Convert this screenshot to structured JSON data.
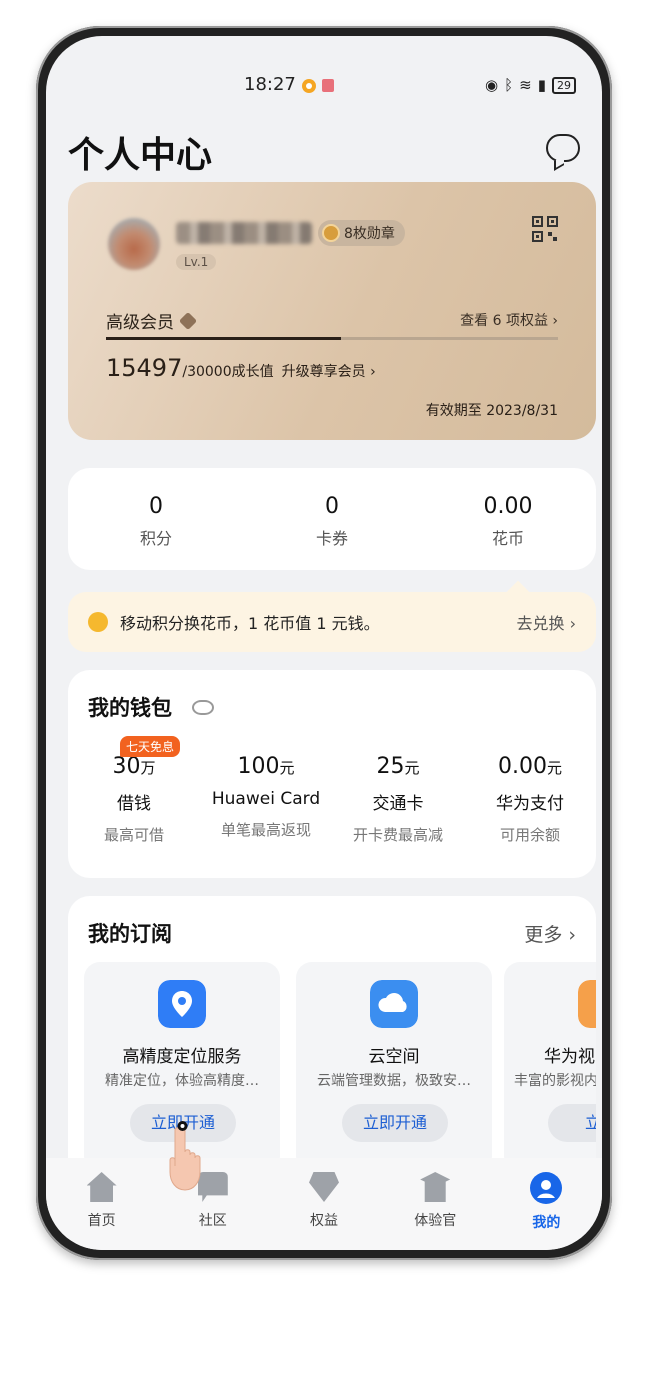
{
  "status_bar": {
    "time": "18:27",
    "battery": "29"
  },
  "header": {
    "title": "个人中心"
  },
  "member_card": {
    "medals": "8枚勋章",
    "level": "Lv.1",
    "tier": "高级会员",
    "benefits": "查看 6 项权益 ›",
    "growth_value": "15497",
    "growth_total": "/30000成长值",
    "upgrade": "升级尊享会员 ›",
    "expiry": "有效期至 2023/8/31",
    "progress_fraction": 0.52
  },
  "stats": [
    {
      "value": "0",
      "label": "积分"
    },
    {
      "value": "0",
      "label": "卡券"
    },
    {
      "value": "0.00",
      "label": "花币"
    }
  ],
  "exchange": {
    "text": "移动积分换花币，1 花币值 1 元钱。",
    "link": "去兑换 ›"
  },
  "wallet": {
    "title": "我的钱包",
    "promo": "七天免息",
    "items": [
      {
        "value": "30",
        "unit": "万",
        "name": "借钱",
        "sub": "最高可借"
      },
      {
        "value": "100",
        "unit": "元",
        "name": "Huawei Card",
        "sub": "单笔最高返现"
      },
      {
        "value": "25",
        "unit": "元",
        "name": "交通卡",
        "sub": "开卡费最高减"
      },
      {
        "value": "0.00",
        "unit": "元",
        "name": "华为支付",
        "sub": "可用余额"
      }
    ]
  },
  "subscriptions": {
    "title": "我的订阅",
    "more": "更多 ›",
    "items": [
      {
        "name": "高精度定位服务",
        "desc": "精准定位，体验高精度…",
        "button": "立即开通",
        "icon_color": "#2f7df6",
        "icon": "location-pin-icon"
      },
      {
        "name": "云空间",
        "desc": "云端管理数据，极致安…",
        "button": "立即开通",
        "icon_color": "#3b8ef0",
        "icon": "cloud-icon"
      },
      {
        "name": "华为视",
        "desc": "丰富的影视内",
        "button": "立即",
        "icon_color": "#f5a04a",
        "icon": "video-icon"
      }
    ]
  },
  "nav": [
    {
      "label": "首页",
      "icon": "home-icon"
    },
    {
      "label": "社区",
      "icon": "chat-icon"
    },
    {
      "label": "权益",
      "icon": "gift-icon"
    },
    {
      "label": "体验官",
      "icon": "graduation-cap-icon"
    },
    {
      "label": "我的",
      "icon": "user-icon",
      "active": true
    }
  ]
}
